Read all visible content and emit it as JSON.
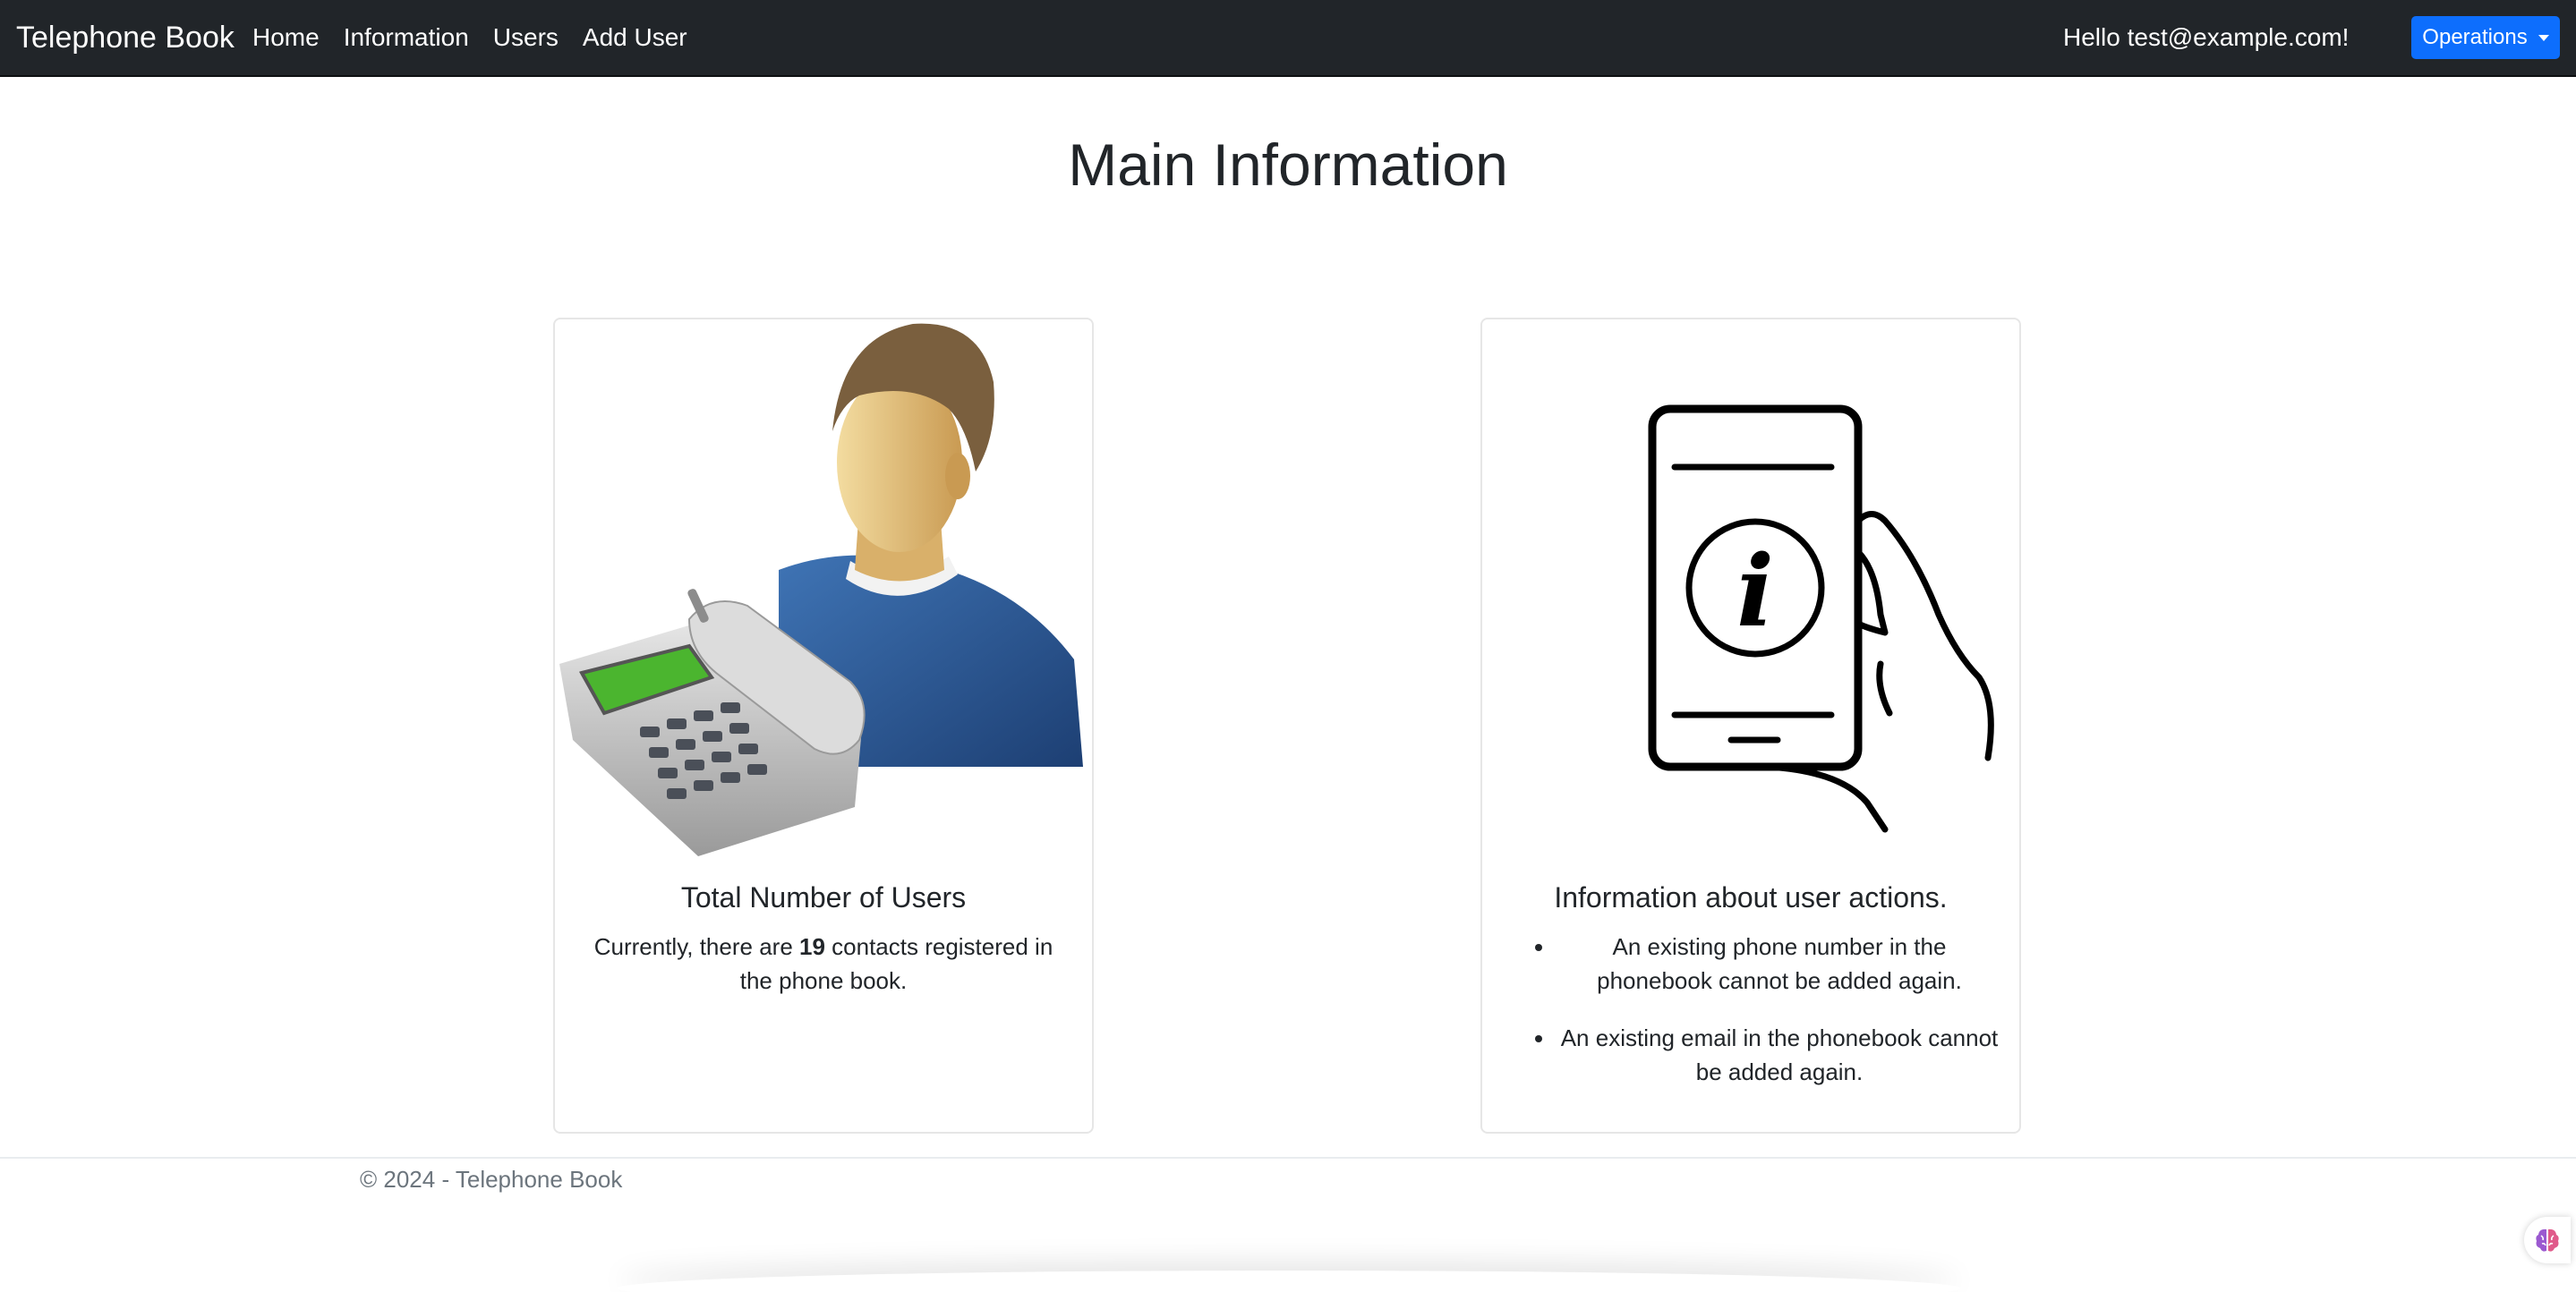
{
  "navbar": {
    "brand": "Telephone Book",
    "links": [
      "Home",
      "Information",
      "Users",
      "Add User"
    ],
    "greeting": "Hello test@example.com!",
    "operations_label": "Operations"
  },
  "page_title": "Main Information",
  "cards": {
    "users": {
      "title": "Total Number of Users",
      "text_before": "Currently, there are ",
      "count": "19",
      "text_after": " contacts registered in the phone book.",
      "image_icon": "user-with-telephone-icon"
    },
    "info": {
      "title": "Information about user actions.",
      "bullets": [
        "An existing phone number in the phonebook cannot be added again.",
        "An existing email in the phonebook cannot be added again."
      ],
      "image_icon": "phone-info-hand-icon"
    }
  },
  "footer": {
    "text": "© 2024 - Telephone Book"
  },
  "widget_icon": "brain-icon",
  "colors": {
    "navbar_bg": "#212529",
    "accent": "#0d6efd",
    "footer_text": "#6c757d"
  }
}
